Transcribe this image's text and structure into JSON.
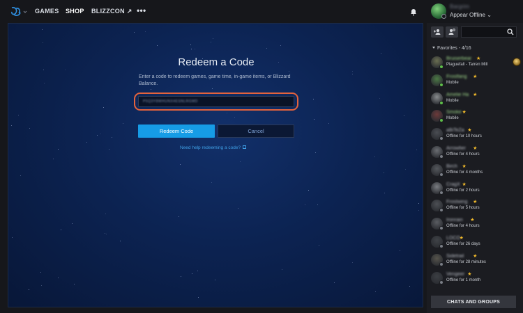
{
  "nav": {
    "games": "GAMES",
    "shop": "SHOP",
    "blizzcon": "BLIZZCON ↗",
    "more": "•••"
  },
  "profile": {
    "name": "Bargrim",
    "status": "Appear Offline ⌄"
  },
  "redeem": {
    "title": "Redeem a Code",
    "description": "Enter a code to redeem games, game time, in-game items, or Blizzard Balance.",
    "code_value": "P5Q3Y8WHUNX4ESNLRGMD",
    "redeem_button": "Redeem Code",
    "cancel_button": "Cancel",
    "help_link": "Need help redeeming a code?"
  },
  "sidebar": {
    "favorites_header": "Favorites - 4/16",
    "chats_button": "CHATS AND GROUPS",
    "friends": [
      {
        "name": "Bruiserbear",
        "status": "Plaguefall - Tarren Mill",
        "state": "online",
        "color": "#5fbf4a",
        "wow": true
      },
      {
        "name": "Frostfang",
        "status": "Mobile",
        "state": "online",
        "color": "#5fbf4a",
        "wow": false
      },
      {
        "name": "Amelie Ha",
        "status": "Mobile",
        "state": "online",
        "color": "#5fbf4a",
        "wow": false
      },
      {
        "name": "Smoke",
        "status": "Mobile",
        "state": "online",
        "color": "#5fbf4a",
        "wow": false
      },
      {
        "name": "aBiTeZa",
        "status": "Offline for 10 hours",
        "state": "offline",
        "color": "#7a7e86",
        "wow": false
      },
      {
        "name": "Arrowfier",
        "status": "Offline for 4 hours",
        "state": "offline",
        "color": "#7a7e86",
        "wow": false
      },
      {
        "name": "Birch",
        "status": "Offline for 4 months",
        "state": "offline",
        "color": "#7a7e86",
        "wow": false
      },
      {
        "name": "CragX",
        "status": "Offline for 2 hours",
        "state": "offline",
        "color": "#7a7e86",
        "wow": false
      },
      {
        "name": "Frostwing",
        "status": "Offline for 5 hours",
        "state": "offline",
        "color": "#7a7e86",
        "wow": false
      },
      {
        "name": "Ironrain",
        "status": "Offline for 4 hours",
        "state": "offline",
        "color": "#7a7e86",
        "wow": false
      },
      {
        "name": "LOCO",
        "status": "Offline for 26 days",
        "state": "offline",
        "color": "#7a7e86",
        "wow": false
      },
      {
        "name": "Sidetrail",
        "status": "Offline for 28 minutes",
        "state": "offline",
        "color": "#7a7e86",
        "wow": false
      },
      {
        "name": "Vengeer",
        "status": "Offline for 1 month",
        "state": "offline",
        "color": "#7a7e86",
        "wow": false
      }
    ]
  },
  "colors": {
    "accent": "#169ce6",
    "highlight": "#e5633c",
    "favorite_star": "#f3bb2a",
    "online": "#5fbf4a"
  }
}
